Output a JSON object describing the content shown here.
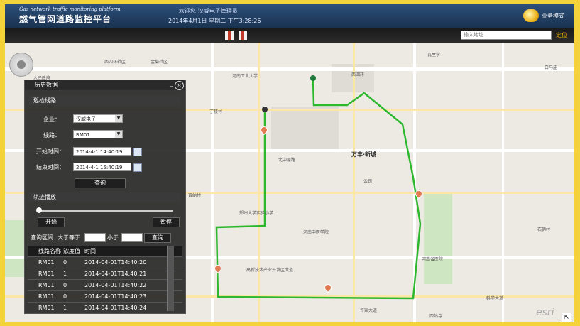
{
  "header": {
    "subtitle": "Gas network traffic monitoring platform",
    "title": "燃气管网道路监控平台",
    "welcome": "欢迎您:汉威电子管理员",
    "datetime": "2014年4月1日 星期二 下午3:28:26",
    "mode_label": "业务模式"
  },
  "toolbar": {
    "address_placeholder": "输入地址",
    "address_button": "定位"
  },
  "panel": {
    "title": "历史数据",
    "section_route": "巡检线路",
    "company_label": "企业：",
    "company_value": "汉威电子",
    "line_label": "线路：",
    "line_value": "RM01",
    "start_label": "开始时间：",
    "start_value": "2014-4-1 14:40:19",
    "end_label": "结束时间：",
    "end_value": "2014-4-1 15:40:19",
    "query_button": "查询",
    "section_playback": "轨迹播放",
    "playback_progress": 0.0,
    "start_button": "开始",
    "pause_button": "暂停",
    "range_label": "查询区间",
    "ge_label": "大于等于",
    "lt_label": "小于",
    "range_query_button": "查询",
    "table": {
      "headers": [
        "线路名称",
        "浓度值",
        "时间"
      ],
      "rows": [
        [
          "RM01",
          "0",
          "2014-04-01T14:40:20"
        ],
        [
          "RM01",
          "1",
          "2014-04-01T14:40:21"
        ],
        [
          "RM01",
          "0",
          "2014-04-01T14:40:22"
        ],
        [
          "RM01",
          "0",
          "2014-04-01T14:40:23"
        ],
        [
          "RM01",
          "1",
          "2014-04-01T14:40:24"
        ]
      ]
    }
  },
  "map": {
    "labels": {
      "l1": "西四环社区",
      "l2": "人民政府",
      "l3": "金菊社区",
      "l4": "河南工业大学",
      "l5": "万丰·新城",
      "l6": "西四环",
      "l7": "北中原路",
      "l8": "郑州大学实验小学",
      "l9": "科学大道",
      "l10": "河南中医学院",
      "l11": "百纳村",
      "l12": "石佛村",
      "l13": "丁楼村",
      "l14": "高新技术产业开发区大道",
      "l15": "瓦屋李",
      "l16": "白马庙",
      "l17": "河南省医院",
      "l18": "公司",
      "l19": "许家大道",
      "l20": "西站寺"
    },
    "esri": "esri",
    "route_color": "#2eb82e"
  }
}
